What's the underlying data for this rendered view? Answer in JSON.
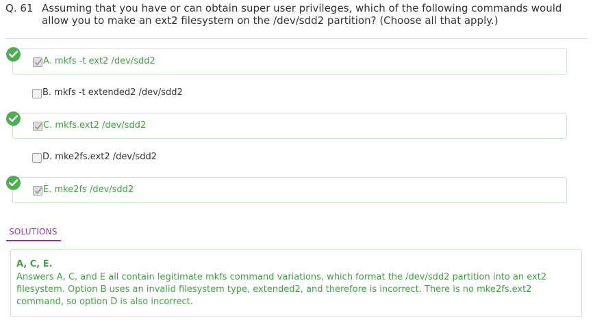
{
  "question": {
    "number": "Q. 61",
    "text": "Assuming that you have or can obtain super user privileges, which of the following commands would allow you to make an ext2 filesystem on the /dev/sdd2 partition? (Choose all that apply.)"
  },
  "options": [
    {
      "label": "A. mkfs -t ext2 /dev/sdd2",
      "checked": true,
      "correct": true
    },
    {
      "label": "B. mkfs -t extended2 /dev/sdd2",
      "checked": false,
      "correct": false
    },
    {
      "label": "C. mkfs.ext2 /dev/sdd2",
      "checked": true,
      "correct": true
    },
    {
      "label": "D. mke2fs.ext2 /dev/sdd2",
      "checked": false,
      "correct": false
    },
    {
      "label": "E. mke2fs /dev/sdd2",
      "checked": true,
      "correct": true
    }
  ],
  "solutions": {
    "tab_label": "SOLUTIONS",
    "answer": "A, C, E.",
    "explanation": "Answers A, C, and E all contain legitimate mkfs command variations, which format the /dev/sdd2 partition into an ext2 filesystem. Option B uses an invalid filesystem type, extended2, and therefore is incorrect. There is no mke2fs.ext2 command, so option D is also incorrect."
  },
  "colors": {
    "correct_green": "#43a047",
    "badge_green": "#4caf50",
    "border_green": "#c8e6c9",
    "tab_purple": "#9c27b0"
  },
  "icons": {
    "correct_badge": "check-circle-icon",
    "checkbox_checked": "checkmark-icon"
  }
}
